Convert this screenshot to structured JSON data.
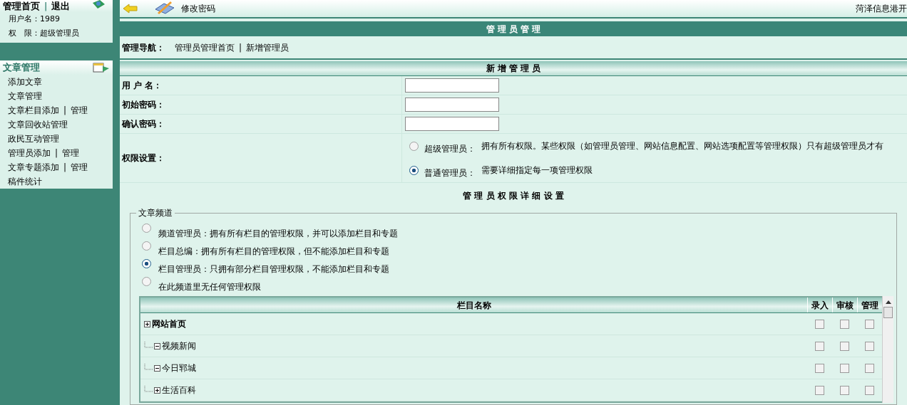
{
  "top_bar": {
    "title": "修改密码",
    "site_name": "菏泽信息港开"
  },
  "sidebar": {
    "user_panel": {
      "links": [
        "管理首页",
        "退出"
      ],
      "separator": "|",
      "lines": [
        {
          "label": "用户名：",
          "value": "1989"
        },
        {
          "label": "权　限：",
          "value": "超级管理员"
        }
      ]
    },
    "menu": {
      "title": "文章管理",
      "separator": "|",
      "items": [
        {
          "links": [
            "添加文章"
          ]
        },
        {
          "links": [
            "文章管理"
          ]
        },
        {
          "links": [
            "文章栏目添加",
            "管理"
          ]
        },
        {
          "links": [
            "文章回收站管理"
          ]
        },
        {
          "links": [
            "政民互动管理"
          ]
        },
        {
          "links": [
            "管理员添加",
            "管理"
          ]
        },
        {
          "links": [
            "文章专题添加",
            "管理"
          ]
        },
        {
          "links": [
            "稿件统计"
          ]
        }
      ]
    }
  },
  "header": {
    "title": "管 理 员 管 理"
  },
  "nav": {
    "label": "管理导航：",
    "links": [
      "管理员管理首页",
      "新增管理员"
    ],
    "separator": "|"
  },
  "form": {
    "title": "新 增 管 理 员",
    "fields": [
      {
        "label": "用 户 名："
      },
      {
        "label": "初始密码："
      },
      {
        "label": "确认密码："
      }
    ],
    "permission": {
      "label": "权限设置：",
      "options": [
        {
          "label": "超级管理员：",
          "description": "拥有所有权限。某些权限（如管理员管理、网站信息配置、网站选项配置等管理权限）只有超级管理员才有",
          "selected": false
        },
        {
          "label": "普通管理员：",
          "description": "需要详细指定每一项管理权限",
          "selected": true
        }
      ]
    }
  },
  "detail": {
    "title": "管 理 员 权 限 详 细 设 置",
    "channel": {
      "legend": "文章频道",
      "options": [
        {
          "label": "频道管理员：拥有所有栏目的管理权限，并可以添加栏目和专题",
          "selected": false
        },
        {
          "label": "栏目总编：拥有所有栏目的管理权限，但不能添加栏目和专题",
          "selected": false
        },
        {
          "label": "栏目管理员：只拥有部分栏目管理权限，不能添加栏目和专题",
          "selected": true
        },
        {
          "label": "在此频道里无任何管理权限",
          "selected": false
        }
      ],
      "table": {
        "columns": [
          "栏目名称",
          "录入",
          "审核",
          "管理"
        ],
        "rows": [
          {
            "name": "网站首页",
            "expanded": false,
            "checks": [
              false,
              false,
              false
            ],
            "children": [
              {
                "name": "视频新闻",
                "expanded": true,
                "checks": [
                  false,
                  false,
                  false
                ]
              },
              {
                "name": "今日郓城",
                "expanded": true,
                "checks": [
                  false,
                  false,
                  false
                ]
              },
              {
                "name": "生活百科",
                "expanded": false,
                "checks": [
                  false,
                  false,
                  false
                ]
              }
            ]
          }
        ]
      }
    }
  }
}
